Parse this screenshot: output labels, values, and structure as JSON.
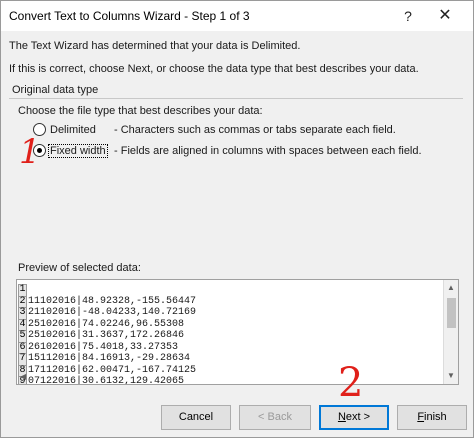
{
  "window": {
    "title": "Convert Text to Columns Wizard - Step 1 of 3",
    "help_label": "?",
    "close_label": "✕"
  },
  "intro": {
    "line1": "The Text Wizard has determined that your data is Delimited.",
    "line2": "If this is correct, choose Next, or choose the data type that best describes your data."
  },
  "original_data_type": {
    "legend": "Original data type",
    "prompt": "Choose the file type that best describes your data:",
    "options": [
      {
        "label": "Delimited",
        "description": "- Characters such as commas or tabs separate each field.",
        "selected": false
      },
      {
        "label": "Fixed width",
        "description": "- Fields are aligned in columns with spaces between each field.",
        "selected": true
      }
    ]
  },
  "annotations": {
    "step1": "1",
    "step2": "2",
    "color": "#e0201a"
  },
  "preview": {
    "label": "Preview of selected data:",
    "rows": [
      {
        "num": "1",
        "text": ""
      },
      {
        "num": "2",
        "text": "11102016|48.92328,-155.56447"
      },
      {
        "num": "3",
        "text": "21102016|-48.04233,140.72169"
      },
      {
        "num": "4",
        "text": "25102016|74.02246,96.55308"
      },
      {
        "num": "5",
        "text": "25102016|31.3637,172.26846"
      },
      {
        "num": "6",
        "text": "26102016|75.4018,33.27353"
      },
      {
        "num": "7",
        "text": "15112016|84.16913,-29.28634"
      },
      {
        "num": "8",
        "text": "17112016|62.00471,-167.74125"
      },
      {
        "num": "9",
        "text": "07122016|30.6132,129.42065"
      }
    ]
  },
  "buttons": {
    "cancel": "Cancel",
    "back": "< Back",
    "next_accel": "N",
    "next_rest": "ext >",
    "finish_accel": "F",
    "finish_rest": "inish"
  }
}
